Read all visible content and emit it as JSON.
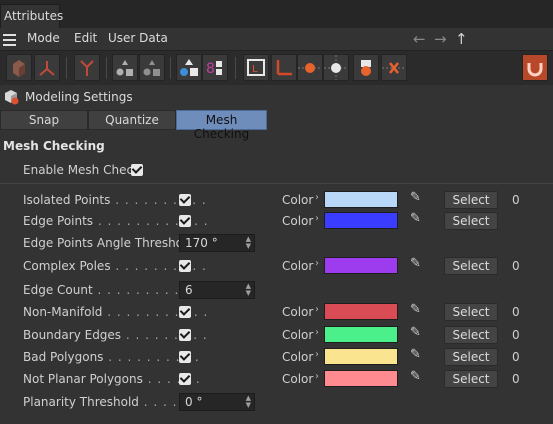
{
  "window": {
    "tab_title": "Attributes"
  },
  "menu": {
    "items": [
      "Mode",
      "Edit",
      "User Data"
    ]
  },
  "object": {
    "title": "Modeling Settings"
  },
  "subtabs": [
    "Snap",
    "Quantize",
    "Mesh Checking"
  ],
  "section": {
    "title": "Mesh Checking",
    "enable_label": "Enable Mesh Check",
    "enable_checked": true
  },
  "color_label": "Color",
  "select_label": "Select",
  "rows": [
    {
      "label": "Isolated Points",
      "dots": " . . . . . . . . . .",
      "kind": "check",
      "checked": true,
      "swatch": "#b9d7f7",
      "count": "0"
    },
    {
      "label": "Edge Points",
      "dots": " . . . . . . . . . . . .",
      "kind": "check",
      "checked": true,
      "swatch": "#3a3cff",
      "count": ""
    },
    {
      "label": "Edge Points Angle Threshold",
      "dots": "",
      "kind": "number",
      "value": "170 °"
    },
    {
      "label": "Complex Poles",
      "dots": " . . . . . . . . . .",
      "kind": "check",
      "checked": true,
      "swatch": "#9d3bef",
      "count": "0"
    },
    {
      "label": "Edge Count",
      "dots": " . . . . . . . . . . . . .",
      "kind": "number",
      "value": "6"
    },
    {
      "label": "Non-Manifold",
      "dots": " . . . . . . . . . . .",
      "kind": "check",
      "checked": true,
      "swatch": "#d94b55",
      "count": "0"
    },
    {
      "label": "Boundary Edges",
      "dots": " . . . . . . . . .",
      "kind": "check",
      "checked": true,
      "swatch": "#4cf08a",
      "count": "0"
    },
    {
      "label": "Bad Polygons",
      "dots": " . . . . . . . . . .",
      "kind": "check",
      "checked": true,
      "swatch": "#fbe48f",
      "count": "0"
    },
    {
      "label": "Not Planar Polygons",
      "dots": " . . . . . .",
      "kind": "check",
      "checked": true,
      "swatch": "#ff8a8f",
      "count": "0"
    },
    {
      "label": "Planarity Threshold",
      "dots": " . . . . . . .",
      "kind": "number",
      "value": "0 °"
    }
  ]
}
